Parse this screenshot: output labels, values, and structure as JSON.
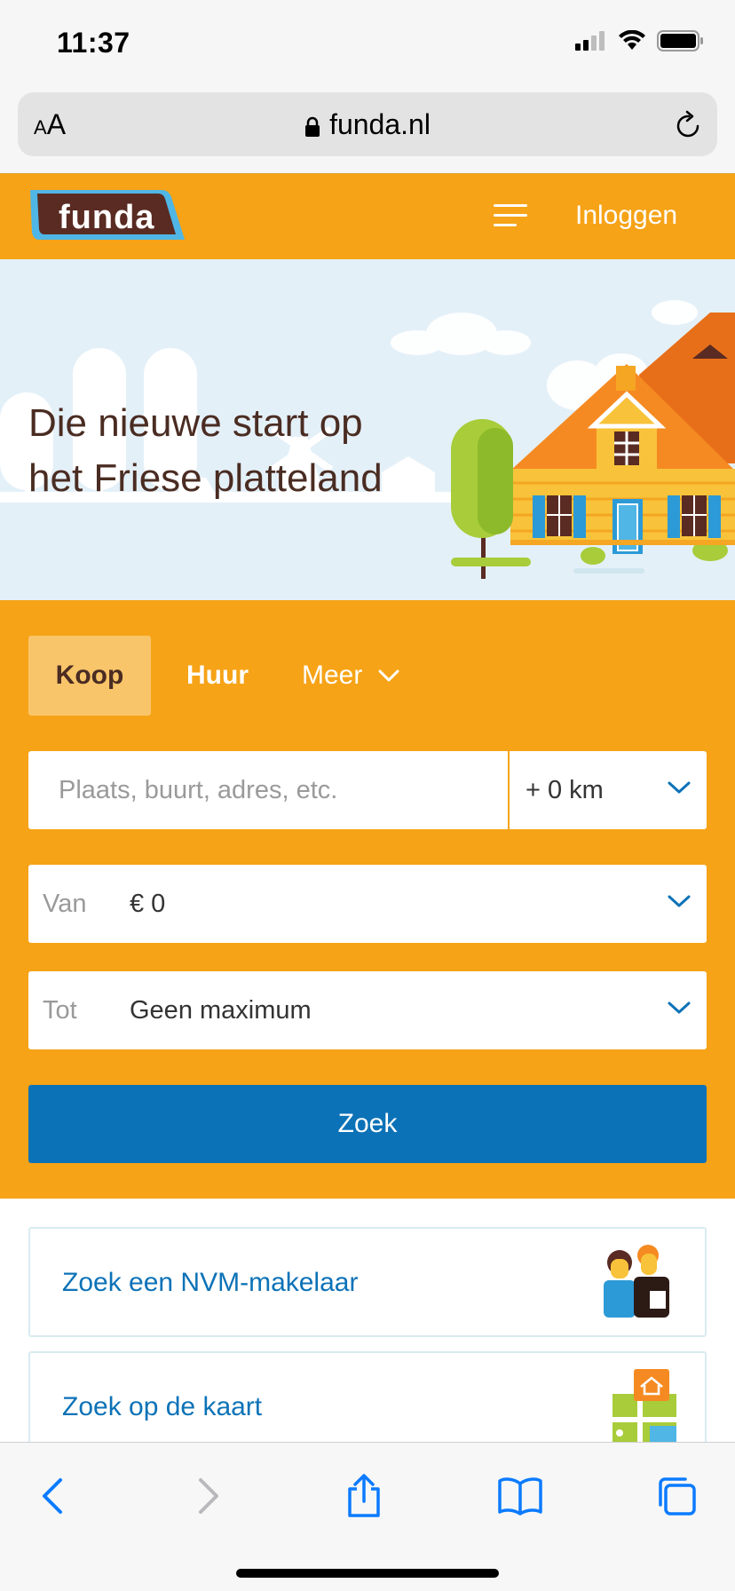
{
  "status_bar": {
    "time": "11:37"
  },
  "browser": {
    "text_size_label": "AA",
    "url": "funda.nl"
  },
  "header": {
    "logo_text": "funda",
    "login_label": "Inloggen"
  },
  "hero": {
    "title": "Die nieuwe start op het Friese platteland"
  },
  "search": {
    "tabs": [
      {
        "label": "Koop",
        "selected": true
      },
      {
        "label": "Huur",
        "selected": false
      },
      {
        "label": "Meer",
        "selected": false
      }
    ],
    "location_placeholder": "Plaats, buurt, adres, etc.",
    "radius_value": "+ 0 km",
    "price_from": {
      "label": "Van",
      "value": "€ 0"
    },
    "price_to": {
      "label": "Tot",
      "value": "Geen maximum"
    },
    "submit_label": "Zoek"
  },
  "links": [
    {
      "label": "Zoek een NVM-makelaar",
      "icon": "agents-illustration"
    },
    {
      "label": "Zoek op de kaart",
      "icon": "map-illustration"
    }
  ],
  "colors": {
    "brand_orange": "#f6a317",
    "brand_blue": "#0c72b7",
    "brand_brown": "#4a2c22",
    "hero_sky": "#e4f0f8"
  },
  "toolbar": {
    "icons": [
      "back-icon",
      "forward-icon",
      "share-icon",
      "bookmarks-icon",
      "tabs-icon"
    ]
  }
}
